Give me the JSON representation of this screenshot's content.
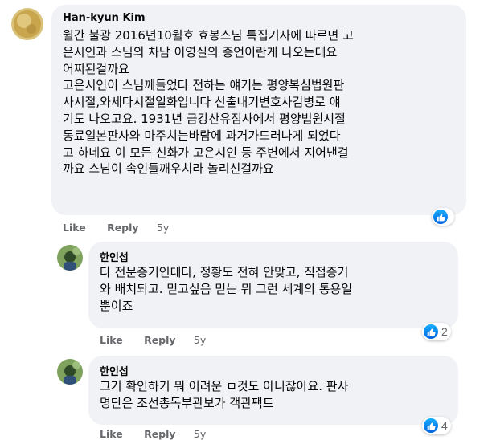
{
  "comments": [
    {
      "author": "Han-kyun Kim",
      "text": "월간 불광 2016년10월호 효봉스님 특집기사에 따르면 고\n은시인과 스님의 차남 이영실의 증언이란게 나오는데요\n어찌된걸까요\n고은시인이 스님께들었다 전하는 얘기는 평양복심법원판\n사시절,와세다시절일화입니다 신출내기변호사김병로 얘\n기도 나오고요. 1931년 금강산유점사에서 평양법원시절\n동료일본판사와 마주치는바람에 과거가드러나게 되었다\n고 하네요 이 모든 신화가 고은시인 등 주변에서 지어낸걸\n까요 스님이 속인들깨우치라 놀리신걸까요",
      "actions": {
        "like": "Like",
        "reply": "Reply",
        "time": "5y"
      },
      "reaction_icon": "like-icon",
      "reaction_count": ""
    },
    {
      "author": "한인섭",
      "text": "다 전문증거인데다, 정황도 전혀 안맞고, 직접증거\n와 배치되고. 믿고싶음 믿는 뭐 그런 세계의 통용일\n뿐이죠",
      "actions": {
        "like": "Like",
        "reply": "Reply",
        "time": "5y"
      },
      "reaction_icon": "like-icon",
      "reaction_count": "2"
    },
    {
      "author": "한인섭",
      "text": "그거 확인하기 뭐 어려운 ㅁ것도 아니잖아요. 판사\n명단은 조선총독부관보가 객관팩트",
      "actions": {
        "like": "Like",
        "reply": "Reply",
        "time": "5y"
      },
      "reaction_icon": "like-icon",
      "reaction_count": "4"
    }
  ],
  "colors": {
    "bubble": "#f0f2f5",
    "text": "#050505",
    "secondary": "#65676b",
    "like_blue": "#1877f2"
  }
}
